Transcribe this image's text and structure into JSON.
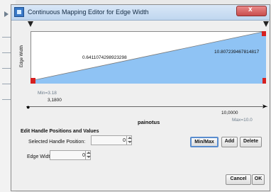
{
  "window": {
    "title": "Continuous Mapping Editor for Edge Width",
    "close_glyph": "x"
  },
  "plot": {
    "y_axis_label": "Edge Width",
    "left_value": "0.6411074298923298",
    "right_value": "10.807239467814817",
    "fill_color": "#8fc3f4",
    "handle_color": "#d62020"
  },
  "axis": {
    "x_label": "painotus",
    "min_label": "Min=3.18",
    "min_value": "3,1800",
    "max_value": "10,0000",
    "max_label": "Max=10.0"
  },
  "edit_section": {
    "title": "Edit Handle Positions and Values",
    "selected_handle_label": "Selected Handle Position:",
    "selected_handle_value": "0",
    "edge_width_label": "Edge Width",
    "edge_width_value": "0"
  },
  "buttons": {
    "min_max": "Min/Max",
    "add": "Add",
    "delete": "Delete",
    "cancel": "Cancel",
    "ok": "OK"
  }
}
